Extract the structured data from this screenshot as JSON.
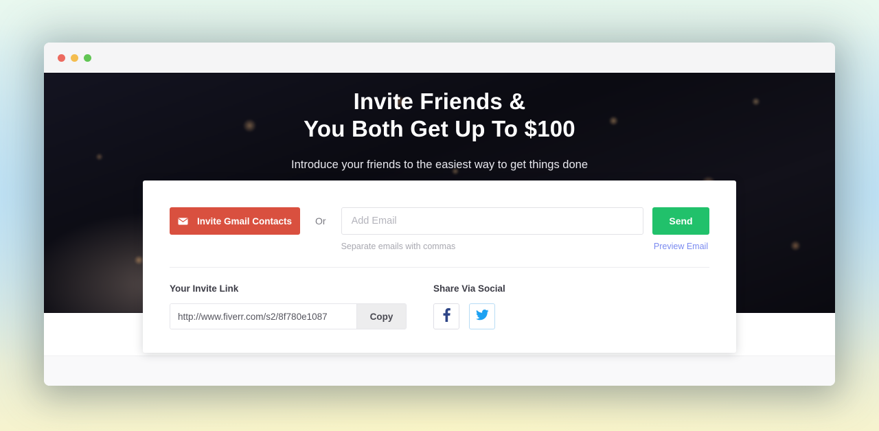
{
  "window": {
    "traffic_lights": [
      {
        "name": "close",
        "color": "#ec6a5f"
      },
      {
        "name": "minimize",
        "color": "#f4bd4f"
      },
      {
        "name": "maximize",
        "color": "#61c554"
      }
    ]
  },
  "hero": {
    "title_line1": "Invite Friends &",
    "title_line2": "You Both Get Up To $100",
    "subtitle": "Introduce your friends to the easiest way to get things done"
  },
  "card": {
    "gmail_button_label": "Invite Gmail Contacts",
    "gmail_button_icon": "envelope-icon",
    "or_label": "Or",
    "email_input_value": "",
    "email_input_placeholder": "Add Email",
    "email_hint": "Separate emails with commas",
    "send_button_label": "Send",
    "preview_email_label": "Preview Email",
    "invite_link_heading": "Your Invite Link",
    "invite_link_value": "http://www.fiverr.com/s2/8f780e1087",
    "copy_button_label": "Copy",
    "share_social_heading": "Share Via Social",
    "social_buttons": [
      {
        "name": "facebook",
        "icon": "facebook-icon",
        "color": "#2d4486"
      },
      {
        "name": "twitter",
        "icon": "twitter-icon",
        "color": "#1da1f2"
      }
    ]
  },
  "colors": {
    "gmail_red": "#d9503f",
    "send_green": "#21c16b",
    "link_blue": "#7a8af0",
    "facebook_blue": "#2d4486",
    "twitter_blue": "#1da1f2",
    "hero_dark": "#0d0d16"
  }
}
